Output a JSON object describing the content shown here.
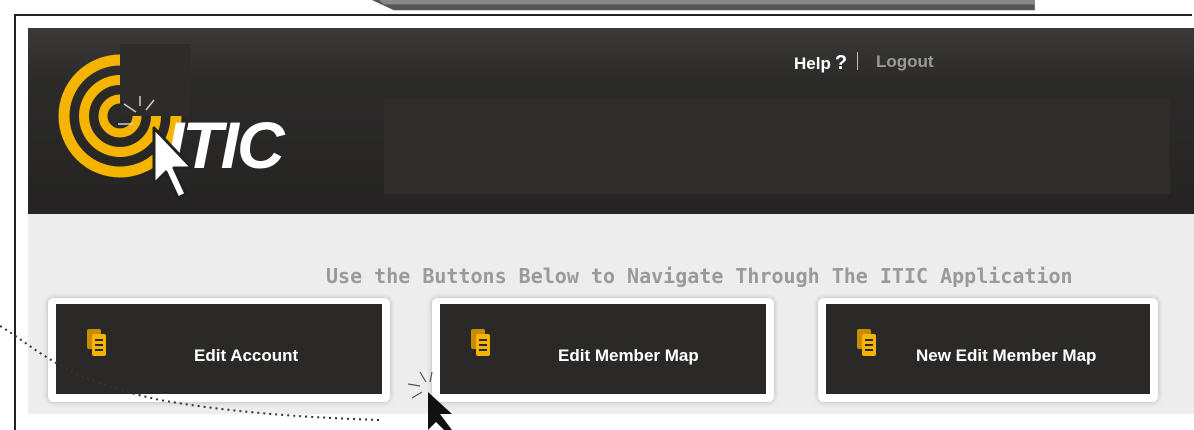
{
  "header": {
    "logo_text": "ITIC",
    "help_label": "Help",
    "help_icon_glyph": "?",
    "logout_label": "Logout"
  },
  "content": {
    "instruction": "Use the Buttons Below to Navigate Through The ITIC Application"
  },
  "buttons": [
    {
      "label": "Edit Account",
      "icon": "document-icon"
    },
    {
      "label": "Edit Member Map",
      "icon": "document-icon"
    },
    {
      "label": "New Edit Member Map",
      "icon": "document-icon"
    }
  ],
  "colors": {
    "header_bg": "#2b2a29",
    "accent_yellow": "#f5b400",
    "content_bg": "#ededed",
    "instruction_text": "#9a9a9a",
    "button_bg": "#2a2928"
  }
}
